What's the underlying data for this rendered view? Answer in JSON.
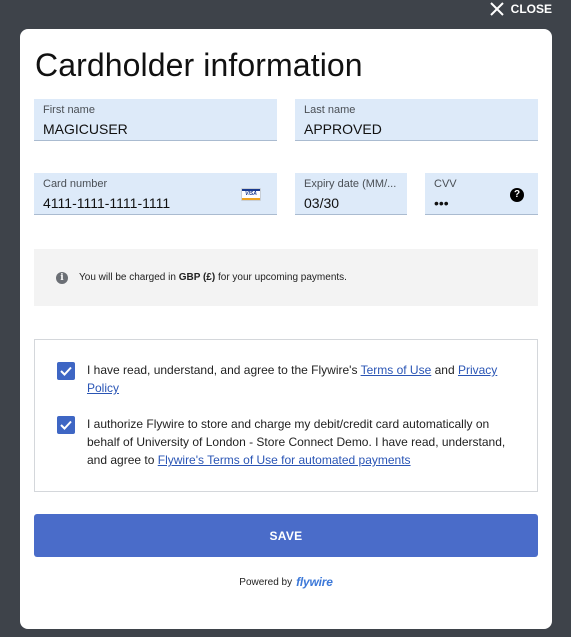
{
  "close": {
    "label": "CLOSE"
  },
  "modal": {
    "title": "Cardholder information",
    "first_name": {
      "label": "First name",
      "value": "MAGICUSER"
    },
    "last_name": {
      "label": "Last name",
      "value": "APPROVED"
    },
    "card_number": {
      "label": "Card number",
      "value": "4111-1111-1111-1111",
      "brand_icon": "visa-card-icon",
      "brand_text": "VISA"
    },
    "expiry": {
      "label": "Expiry date (MM/...",
      "value": "03/30"
    },
    "cvv": {
      "label": "CVV",
      "value": "•••",
      "help_glyph": "?"
    },
    "notice": {
      "info_glyph": "i",
      "prefix": "You will be charged in ",
      "currency": "GBP (£)",
      "suffix": " for your upcoming payments."
    },
    "consent1": {
      "text_before": "I have read, understand, and agree to the Flywire's ",
      "link1": "Terms of Use",
      "middle": " and ",
      "link2": "Privacy Policy",
      "checked": true
    },
    "consent2": {
      "text_before": "I authorize Flywire to store and charge my debit/credit card automatically on behalf of University of London - Store Connect Demo. I have read, understand, and agree to ",
      "link": "Flywire's Terms of Use for automated payments",
      "checked": true
    },
    "save_label": "SAVE",
    "powered_by": "Powered by",
    "brand": "flywire"
  },
  "colors": {
    "overlay": "#3e434a",
    "field_bg": "#ddeaf9",
    "accent": "#4a6cc9",
    "checkbox": "#3e66c4",
    "link": "#2a55b5"
  }
}
